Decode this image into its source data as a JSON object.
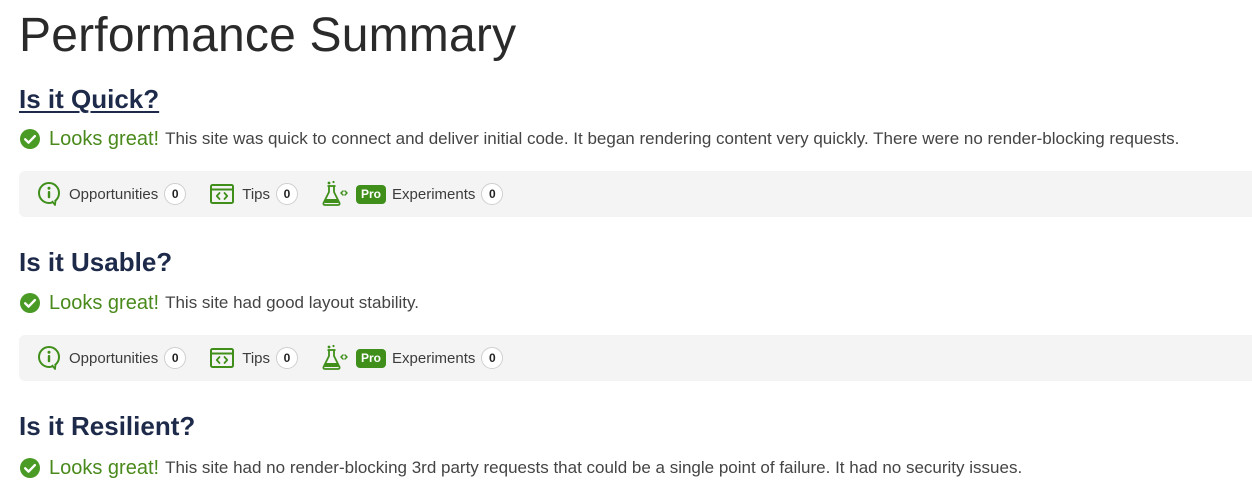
{
  "page": {
    "title": "Performance Summary"
  },
  "colors": {
    "heading": "#1e2a4a",
    "success": "#4a8a1c",
    "pro_badge": "#3f8f1a",
    "toolbar_bg": "#f4f4f4"
  },
  "sections": [
    {
      "heading": "Is it Quick?",
      "status": "Looks great!",
      "description": "This site was quick to connect and deliver initial code. It began rendering content very quickly. There were no render-blocking requests.",
      "toolbar": {
        "opportunities_label": "Opportunities",
        "opportunities_count": "0",
        "tips_label": "Tips",
        "tips_count": "0",
        "pro_label": "Pro",
        "experiments_label": "Experiments",
        "experiments_count": "0"
      }
    },
    {
      "heading": "Is it Usable?",
      "status": "Looks great!",
      "description": "This site had good layout stability.",
      "toolbar": {
        "opportunities_label": "Opportunities",
        "opportunities_count": "0",
        "tips_label": "Tips",
        "tips_count": "0",
        "pro_label": "Pro",
        "experiments_label": "Experiments",
        "experiments_count": "0"
      }
    },
    {
      "heading": "Is it Resilient?",
      "status": "Looks great!",
      "description": "This site had no render-blocking 3rd party requests that could be a single point of failure. It had no security issues."
    }
  ],
  "icons": {
    "status": "check-circle-icon",
    "opportunities": "lightbulb-info-icon",
    "tips": "code-window-icon",
    "experiments": "flask-icon"
  }
}
